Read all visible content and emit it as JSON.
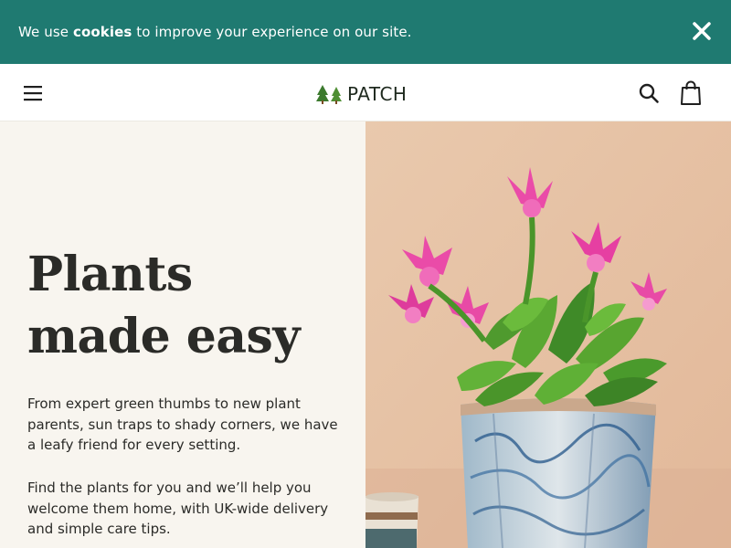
{
  "cookie_banner": {
    "prefix": "We use",
    "bold": "cookies",
    "suffix": "to improve your experience on our site."
  },
  "header": {
    "logo_text": "PATCH"
  },
  "hero": {
    "title": "Plants made easy",
    "paragraph_1": "From expert green thumbs to new plant parents, sun traps to shady corners, we have a leafy friend for every setting.",
    "paragraph_2": "Find the plants for you and we’ll help you welcome them home, with UK-wide delivery and simple care tips."
  },
  "icons": [
    "close-icon",
    "menu-icon",
    "tree-logo-icon",
    "search-icon",
    "bag-icon"
  ],
  "colors": {
    "banner": "#1f7a71",
    "text": "#2b2b28",
    "hero_left_bg": "#f8f5ef",
    "wall": "#e8c4a8"
  }
}
